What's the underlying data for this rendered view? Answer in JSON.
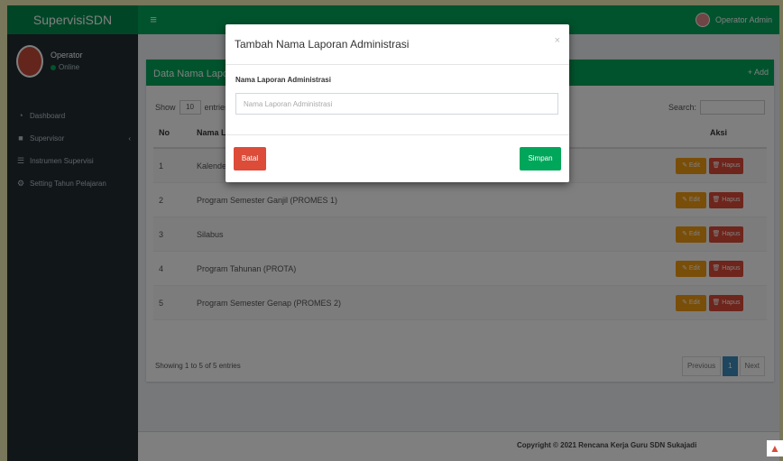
{
  "header": {
    "logo": "SupervisiSDN",
    "toggle_icon": "≡",
    "user_name": "Operator Admin"
  },
  "sidebar": {
    "user_name": "Operator",
    "user_status": "Online",
    "items": [
      {
        "label": "Dashboard",
        "icon": "tachometer-icon"
      },
      {
        "label": "Supervisor",
        "icon": "users-icon"
      },
      {
        "label": "Instrumen Supervisi",
        "icon": "list-icon"
      },
      {
        "label": "Setting Tahun Pelajaran",
        "icon": "gear-icon"
      }
    ]
  },
  "box": {
    "title": "Data Nama Laporan Administrasi",
    "add_label": "+ Add",
    "show_label": "Show",
    "entries_value": "10",
    "entries_label": "entries",
    "search_label": "Search:"
  },
  "table": {
    "headers": [
      "No",
      "Nama Laporan Administrasi",
      "Aksi"
    ],
    "rows": [
      {
        "no": "1",
        "name": "Kalender Pendidikan"
      },
      {
        "no": "2",
        "name": "Program Semester Ganjil (PROMES 1)"
      },
      {
        "no": "3",
        "name": "Silabus"
      },
      {
        "no": "4",
        "name": "Program Tahunan (PROTA)"
      },
      {
        "no": "5",
        "name": "Program Semester Genap (PROMES 2)"
      }
    ],
    "edit_label": "✎ Edit",
    "delete_label": "🗑 Hapus",
    "info": "Showing 1 to 5 of 5 entries",
    "prev_label": "Previous",
    "page": "1",
    "next_label": "Next"
  },
  "footer": {
    "copyright": "Copyright © 2021 Rencana Kerja Guru SDN Sukajadi"
  },
  "modal": {
    "title": "Tambah Nama Laporan Administrasi",
    "close": "×",
    "field_label": "Nama Laporan Administrasi",
    "field_placeholder": "Nama Laporan Administrasi",
    "cancel_label": "Batal",
    "save_label": "Simpan"
  },
  "colors": {
    "accent": "#00a65a",
    "danger": "#dd4b39",
    "warning": "#f39c12",
    "sidebar": "#222d32"
  }
}
